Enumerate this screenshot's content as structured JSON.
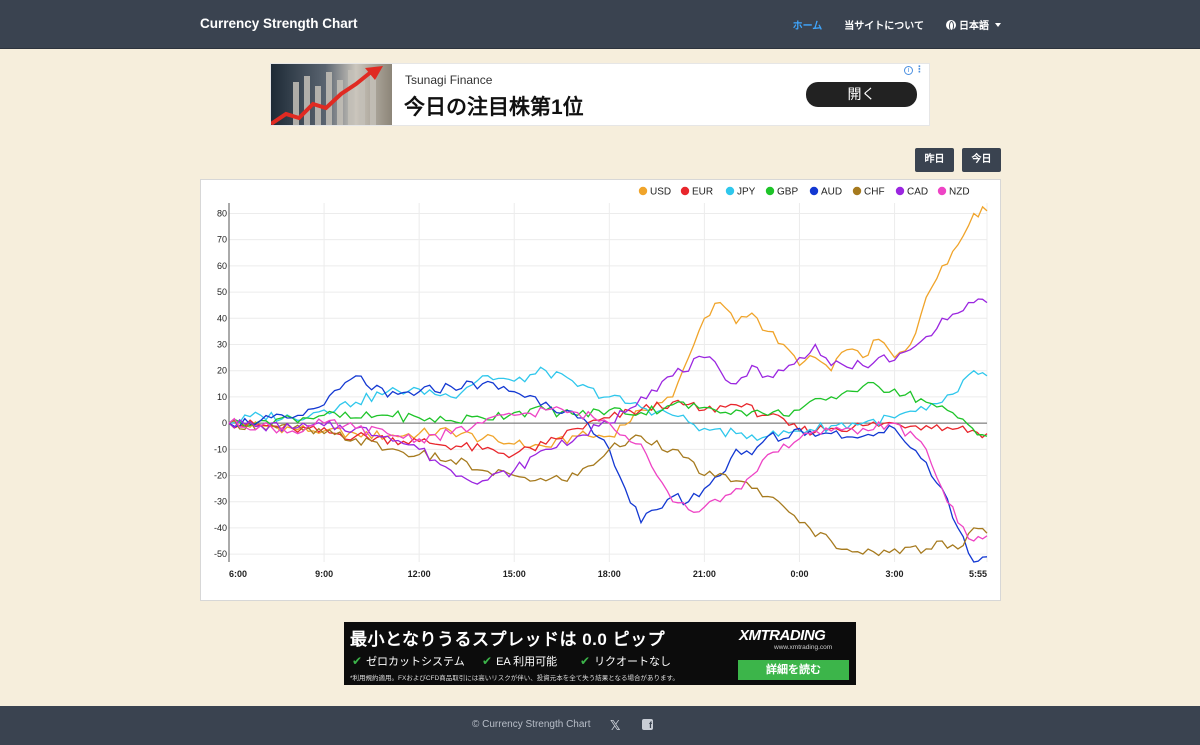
{
  "navbar": {
    "brand": "Currency Strength Chart",
    "items": [
      {
        "label": "ホーム",
        "active": true
      },
      {
        "label": "当サイトについて",
        "active": false
      },
      {
        "label": "日本語",
        "active": false
      }
    ]
  },
  "ad_top": {
    "brand": "Tsunagi Finance",
    "headline": "今日の注目株第1位",
    "button": "開く",
    "info_icon": "i",
    "menu_icon": "⋮"
  },
  "buttons": {
    "yesterday": "昨日",
    "today": "今日"
  },
  "chart_data": {
    "type": "line",
    "title": "",
    "xlabel": "",
    "ylabel": "",
    "ylim": [
      -53,
      84
    ],
    "yticks": [
      80,
      70,
      60,
      50,
      40,
      30,
      20,
      10,
      0,
      -10,
      -20,
      -30,
      -40,
      -50
    ],
    "xticks": [
      "6:00",
      "9:00",
      "12:00",
      "15:00",
      "18:00",
      "21:00",
      "0:00",
      "3:00",
      "5:55"
    ],
    "xtick_hours": [
      0,
      3,
      6,
      9,
      12,
      15,
      18,
      21,
      23.917
    ],
    "grid": true,
    "legend_placement": "top-right",
    "series": [
      {
        "name": "USD",
        "color": "#f0a42a",
        "points": [
          [
            0,
            0
          ],
          [
            1,
            -1
          ],
          [
            2,
            -2
          ],
          [
            3,
            -3
          ],
          [
            4,
            -4
          ],
          [
            5,
            -5
          ],
          [
            6,
            -4
          ],
          [
            7,
            -3
          ],
          [
            8,
            -6
          ],
          [
            9,
            -8
          ],
          [
            10,
            -9
          ],
          [
            11,
            -5
          ],
          [
            12,
            -5
          ],
          [
            13,
            5
          ],
          [
            14,
            10
          ],
          [
            14.5,
            25
          ],
          [
            15,
            40
          ],
          [
            15.5,
            46
          ],
          [
            16,
            38
          ],
          [
            16.5,
            42
          ],
          [
            17,
            35
          ],
          [
            17.5,
            30
          ],
          [
            18,
            22
          ],
          [
            18.5,
            25
          ],
          [
            19,
            20
          ],
          [
            19.5,
            28
          ],
          [
            20,
            25
          ],
          [
            20.5,
            32
          ],
          [
            21,
            25
          ],
          [
            21.5,
            30
          ],
          [
            22,
            48
          ],
          [
            22.5,
            60
          ],
          [
            23,
            68
          ],
          [
            23.5,
            80
          ],
          [
            23.917,
            81
          ]
        ]
      },
      {
        "name": "EUR",
        "color": "#e8262c",
        "points": [
          [
            0,
            0
          ],
          [
            2,
            -2
          ],
          [
            4,
            -5
          ],
          [
            6,
            -7
          ],
          [
            8,
            -10
          ],
          [
            9,
            -12
          ],
          [
            10,
            -8
          ],
          [
            11,
            -2
          ],
          [
            12,
            2
          ],
          [
            13,
            5
          ],
          [
            14,
            8
          ],
          [
            15,
            5
          ],
          [
            16,
            7
          ],
          [
            17,
            3
          ],
          [
            18,
            -3
          ],
          [
            19,
            -2
          ],
          [
            20,
            -1
          ],
          [
            21,
            0
          ],
          [
            22,
            -1
          ],
          [
            23,
            -2
          ],
          [
            23.917,
            -4
          ]
        ]
      },
      {
        "name": "JPY",
        "color": "#2fc7ec",
        "points": [
          [
            0,
            0
          ],
          [
            1,
            3
          ],
          [
            2,
            2
          ],
          [
            3,
            5
          ],
          [
            4,
            8
          ],
          [
            5,
            12
          ],
          [
            6,
            13
          ],
          [
            7,
            10
          ],
          [
            8,
            18
          ],
          [
            9,
            16
          ],
          [
            10,
            20
          ],
          [
            11,
            14
          ],
          [
            12,
            10
          ],
          [
            13,
            6
          ],
          [
            14,
            3
          ],
          [
            15,
            -2
          ],
          [
            16,
            -4
          ],
          [
            17,
            -5
          ],
          [
            18,
            -3
          ],
          [
            19,
            -1
          ],
          [
            20,
            0
          ],
          [
            21,
            2
          ],
          [
            22,
            5
          ],
          [
            23,
            12
          ],
          [
            23.5,
            20
          ],
          [
            23.917,
            18
          ]
        ]
      },
      {
        "name": "GBP",
        "color": "#1ec429",
        "points": [
          [
            0,
            0
          ],
          [
            1,
            1
          ],
          [
            2,
            2
          ],
          [
            3,
            3
          ],
          [
            4,
            2
          ],
          [
            5,
            3
          ],
          [
            6,
            2
          ],
          [
            7,
            1
          ],
          [
            8,
            2
          ],
          [
            9,
            4
          ],
          [
            10,
            5
          ],
          [
            11,
            3
          ],
          [
            12,
            5
          ],
          [
            13,
            4
          ],
          [
            14,
            7
          ],
          [
            15,
            6
          ],
          [
            16,
            5
          ],
          [
            17,
            3
          ],
          [
            18,
            5
          ],
          [
            19,
            10
          ],
          [
            20,
            14
          ],
          [
            21,
            13
          ],
          [
            22,
            8
          ],
          [
            23,
            2
          ],
          [
            23.917,
            -5
          ]
        ]
      },
      {
        "name": "AUD",
        "color": "#1338d2",
        "points": [
          [
            0,
            0
          ],
          [
            1,
            1
          ],
          [
            2,
            2
          ],
          [
            3,
            7
          ],
          [
            4,
            18
          ],
          [
            5,
            10
          ],
          [
            6,
            12
          ],
          [
            7,
            14
          ],
          [
            8,
            15
          ],
          [
            9,
            12
          ],
          [
            10,
            8
          ],
          [
            11,
            2
          ],
          [
            12,
            -10
          ],
          [
            12.5,
            -25
          ],
          [
            13,
            -38
          ],
          [
            13.5,
            -33
          ],
          [
            14,
            -28
          ],
          [
            14.5,
            -30
          ],
          [
            15,
            -25
          ],
          [
            15.5,
            -20
          ],
          [
            16,
            -10
          ],
          [
            16.5,
            -12
          ],
          [
            17,
            -5
          ],
          [
            17.5,
            -6
          ],
          [
            18,
            -2
          ],
          [
            18.5,
            -5
          ],
          [
            19,
            -4
          ],
          [
            20,
            -5
          ],
          [
            21,
            -2
          ],
          [
            22,
            -15
          ],
          [
            22.5,
            -25
          ],
          [
            23,
            -40
          ],
          [
            23.5,
            -53
          ],
          [
            23.917,
            -51
          ]
        ]
      },
      {
        "name": "CHF",
        "color": "#a67a1e",
        "points": [
          [
            0,
            0
          ],
          [
            1,
            -1
          ],
          [
            2,
            -2
          ],
          [
            3,
            -4
          ],
          [
            4,
            -6
          ],
          [
            5,
            -10
          ],
          [
            6,
            -12
          ],
          [
            7,
            -14
          ],
          [
            8,
            -18
          ],
          [
            9,
            -20
          ],
          [
            10,
            -22
          ],
          [
            11,
            -20
          ],
          [
            12,
            -10
          ],
          [
            13,
            -5
          ],
          [
            14,
            -10
          ],
          [
            15,
            -20
          ],
          [
            16,
            -22
          ],
          [
            17,
            -28
          ],
          [
            18,
            -38
          ],
          [
            19,
            -45
          ],
          [
            20,
            -50
          ],
          [
            21,
            -48
          ],
          [
            22,
            -48
          ],
          [
            22.5,
            -45
          ],
          [
            23,
            -48
          ],
          [
            23.5,
            -40
          ],
          [
            23.917,
            -42
          ]
        ]
      },
      {
        "name": "CAD",
        "color": "#9b26e0",
        "points": [
          [
            0,
            0
          ],
          [
            1,
            -1
          ],
          [
            2,
            -2
          ],
          [
            3,
            -1
          ],
          [
            4,
            -2
          ],
          [
            5,
            -5
          ],
          [
            6,
            -10
          ],
          [
            7,
            -18
          ],
          [
            8,
            -22
          ],
          [
            9,
            -18
          ],
          [
            10,
            -10
          ],
          [
            11,
            -5
          ],
          [
            12,
            0
          ],
          [
            13,
            10
          ],
          [
            14,
            18
          ],
          [
            15,
            25
          ],
          [
            15.5,
            20
          ],
          [
            16,
            15
          ],
          [
            16.5,
            22
          ],
          [
            17,
            18
          ],
          [
            17.5,
            20
          ],
          [
            18,
            25
          ],
          [
            18.5,
            30
          ],
          [
            19,
            22
          ],
          [
            20,
            22
          ],
          [
            20.5,
            25
          ],
          [
            21,
            24
          ],
          [
            21.5,
            28
          ],
          [
            22,
            33
          ],
          [
            22.5,
            40
          ],
          [
            23,
            42
          ],
          [
            23.5,
            46
          ],
          [
            23.917,
            46
          ]
        ]
      },
      {
        "name": "NZD",
        "color": "#ee44c5",
        "points": [
          [
            0,
            0
          ],
          [
            1,
            -1
          ],
          [
            2,
            -3
          ],
          [
            3,
            0
          ],
          [
            4,
            -2
          ],
          [
            5,
            -4
          ],
          [
            6,
            -6
          ],
          [
            7,
            -4
          ],
          [
            8,
            0
          ],
          [
            9,
            3
          ],
          [
            10,
            5
          ],
          [
            11,
            4
          ],
          [
            12,
            0
          ],
          [
            13,
            -8
          ],
          [
            13.5,
            -20
          ],
          [
            14,
            -30
          ],
          [
            14.5,
            -33
          ],
          [
            15,
            -32
          ],
          [
            15.5,
            -30
          ],
          [
            16,
            -25
          ],
          [
            16.5,
            -20
          ],
          [
            17,
            -12
          ],
          [
            18,
            -6
          ],
          [
            19,
            -3
          ],
          [
            20,
            -2
          ],
          [
            21,
            0
          ],
          [
            22,
            -10
          ],
          [
            22.5,
            -25
          ],
          [
            23,
            -38
          ],
          [
            23.5,
            -45
          ],
          [
            23.917,
            -43
          ]
        ]
      }
    ]
  },
  "ad_bottom": {
    "headline": "最小となりうるスプレッドは 0.0 ピップ",
    "features": [
      "ゼロカットシステム",
      "EA 利用可能",
      "リクオートなし"
    ],
    "disclaimer": "*利用規約適用。FXおよびCFD商品取引には高いリスクが伴い、投資元本を全て失う結果となる場合があります。",
    "logo": "XMTRADING",
    "logo_sub": "www.xmtrading.com",
    "button": "詳細を読む"
  },
  "footer": {
    "copyright": "© Currency Strength Chart",
    "x_icon": "𝕏",
    "fb_icon": "f"
  }
}
